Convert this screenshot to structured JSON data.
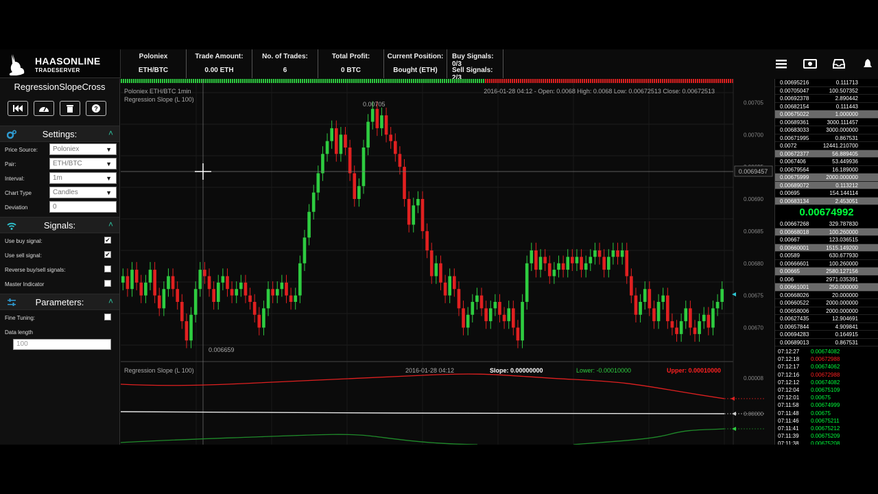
{
  "header": {
    "brand": "HAASONLINE",
    "sub": "TRADESERVER",
    "stats": [
      {
        "label": "Poloniex",
        "value": "ETH/BTC"
      },
      {
        "label": "Trade Amount:",
        "value": "0.00 ETH"
      },
      {
        "label": "No. of Trades:",
        "value": "6"
      },
      {
        "label": "Total Profit:",
        "value": "0 BTC"
      },
      {
        "label": "Current Position:",
        "value": "Bought (ETH)"
      }
    ],
    "buy_signals": "Buy Signals: 0/3",
    "sell_signals": "Sell Signals: 2/3",
    "icons": [
      "menu-icon",
      "money-icon",
      "inbox-icon",
      "bell-icon"
    ]
  },
  "sidebar": {
    "bot_name": "RegressionSlopeCross",
    "buttons": [
      "rewind-icon",
      "dashboard-icon",
      "trash-icon",
      "help-icon"
    ],
    "settings_title": "Settings:",
    "price_source_label": "Price Source:",
    "price_source": "Poloniex",
    "pair_label": "Pair:",
    "pair": "ETH/BTC",
    "interval_label": "Interval:",
    "interval": "1m",
    "chart_type_label": "Chart Type",
    "chart_type": "Candles",
    "deviation_label": "Deviation",
    "deviation": "0",
    "signals_title": "Signals:",
    "signals": [
      {
        "label": "Use buy signal:",
        "checked": true
      },
      {
        "label": "Use sell signal:",
        "checked": true
      },
      {
        "label": "Reverse buy/sell signals:",
        "checked": false
      },
      {
        "label": "Master Indicator",
        "checked": false
      }
    ],
    "parameters_title": "Parameters:",
    "fine_tuning_label": "Fine Tuning:",
    "data_length_label": "Data length",
    "data_length": "100"
  },
  "chart": {
    "title": "Poloniex ETH/BTC 1min",
    "subtitle": "Regression Slope (L 100)",
    "ohlc": "2016-01-28 04:12 - Open: 0.0068 High: 0.0068 Low: 0.00672513 Close: 0.00672513",
    "high_label": "0.00705",
    "low_label": "0.006659",
    "crosshair_price": "0.0069457",
    "price_ticks": [
      "0.00705",
      "0.00700",
      "0.00695",
      "0.00690",
      "0.00685",
      "0.00680",
      "0.00675",
      "0.00670"
    ],
    "lower_title": "Regression Slope (L 100)",
    "lower_time": "2016-01-28 04:12",
    "slope": "Slope: 0.00000000",
    "lower": "Lower: -0.00010000",
    "upper": "Upper: 0.00010000",
    "lower_ticks": [
      "0.00008",
      "0.00000"
    ],
    "colors": {
      "up": "#2ecc40",
      "down": "#e02020",
      "upper_line": "#e02020",
      "slope_line": "#e8e8e8",
      "lower_line": "#1f8a2a"
    }
  },
  "chart_data": {
    "type": "candlestick",
    "ylim": [
      0.00666,
      0.00706
    ],
    "close": [
      0.00678,
      0.00676,
      0.00679,
      0.00677,
      0.00675,
      0.00677,
      0.00679,
      0.00675,
      0.00673,
      0.00676,
      0.00678,
      0.00676,
      0.00674,
      0.00671,
      0.00668,
      0.00672,
      0.00676,
      0.00679,
      0.00678,
      0.00676,
      0.00674,
      0.00677,
      0.00678,
      0.00676,
      0.00675,
      0.00676,
      0.00677,
      0.00675,
      0.00674,
      0.00672,
      0.0067,
      0.00673,
      0.00676,
      0.00675,
      0.00676,
      0.00677,
      0.00675,
      0.00674,
      0.00675,
      0.0068,
      0.00684,
      0.00688,
      0.00691,
      0.00694,
      0.00697,
      0.00699,
      0.00701,
      0.00697,
      0.007,
      0.00698,
      0.00694,
      0.0069,
      0.00692,
      0.00698,
      0.00702,
      0.00704,
      0.00701,
      0.00703,
      0.007,
      0.00699,
      0.00697,
      0.00695,
      0.0069,
      0.00686,
      0.00689,
      0.0069,
      0.00685,
      0.00682,
      0.00678,
      0.0068,
      0.00677,
      0.00675,
      0.00678,
      0.00676,
      0.00673,
      0.0067,
      0.00672,
      0.00674,
      0.00675,
      0.00673,
      0.00671,
      0.00673,
      0.00674,
      0.00672,
      0.00671,
      0.00673,
      0.0067,
      0.00668,
      0.00674,
      0.0068,
      0.00682,
      0.00679,
      0.00681,
      0.0068,
      0.00678,
      0.00679,
      0.0068,
      0.00679,
      0.00681,
      0.0068,
      0.00681,
      0.00679,
      0.0068,
      0.00681,
      0.00682,
      0.00681,
      0.00679,
      0.00681,
      0.00682,
      0.00681,
      0.00682,
      0.00678,
      0.00675,
      0.00672,
      0.00674,
      0.00676,
      0.00673,
      0.00671,
      0.00674,
      0.00675,
      0.00671,
      0.0067,
      0.00669,
      0.00671,
      0.00673,
      0.0067,
      0.00669,
      0.00671,
      0.00672,
      0.0067,
      0.00673,
      0.00674,
      0.00676
    ],
    "slope": [
      0.0,
      0.0,
      0.0
    ]
  },
  "orderbook": {
    "asks": [
      [
        "0.00695216",
        "0.111713",
        false
      ],
      [
        "0.00705047",
        "100.507352",
        false
      ],
      [
        "0.00692378",
        "2.890442",
        false
      ],
      [
        "0.00682154",
        "0.111443",
        false
      ],
      [
        "0.00675022",
        "1.000000",
        true
      ],
      [
        "0.00689361",
        "3000.111457",
        false
      ],
      [
        "0.00683033",
        "3000.000000",
        false
      ],
      [
        "0.00671995",
        "0.867531",
        false
      ],
      [
        "0.0072",
        "12441.210700",
        false
      ],
      [
        "0.00672377",
        "56.889405",
        true
      ],
      [
        "0.0067406",
        "53.449936",
        false
      ],
      [
        "0.00679564",
        "16.189000",
        false
      ],
      [
        "0.00675999",
        "2000.000000",
        true
      ],
      [
        "0.00689072",
        "0.113212",
        true
      ],
      [
        "0.00695",
        "154.144114",
        false
      ],
      [
        "0.00683134",
        "2.453051",
        true
      ]
    ],
    "last_price": "0.00674992",
    "bids": [
      [
        "0.00667268",
        "329.787830",
        false
      ],
      [
        "0.00668018",
        "100.260000",
        true
      ],
      [
        "0.00667",
        "123.036515",
        false
      ],
      [
        "0.00660001",
        "1515.149200",
        true
      ],
      [
        "0.00589",
        "630.677930",
        false
      ],
      [
        "0.00666601",
        "100.260000",
        false
      ],
      [
        "0.00665",
        "2580.127156",
        true
      ],
      [
        "0.006",
        "2971.035391",
        false
      ],
      [
        "0.00661001",
        "250.000000",
        true
      ],
      [
        "0.00668026",
        "20.000000",
        false
      ],
      [
        "0.00660522",
        "2000.000000",
        false
      ],
      [
        "0.00658006",
        "2000.000000",
        false
      ],
      [
        "0.00627435",
        "12.904691",
        false
      ],
      [
        "0.00657844",
        "4.909841",
        false
      ],
      [
        "0.00694283",
        "0.164915",
        false
      ],
      [
        "0.00689013",
        "0.867531",
        false
      ]
    ],
    "trades": [
      [
        "07:12:27",
        "0.00674082",
        false
      ],
      [
        "07:12:18",
        "0.00672988",
        true
      ],
      [
        "07:12:17",
        "0.00674062",
        false
      ],
      [
        "07:12:16",
        "0.00672988",
        true
      ],
      [
        "07:12:12",
        "0.00674082",
        false
      ],
      [
        "07:12:04",
        "0.00675109",
        false
      ],
      [
        "07:12:01",
        "0.00675",
        false
      ],
      [
        "07:11:58",
        "0.00674999",
        false
      ],
      [
        "07:11:48",
        "0.00675",
        false
      ],
      [
        "07:11:46",
        "0.00675211",
        false
      ],
      [
        "07:11:41",
        "0.00675212",
        false
      ],
      [
        "07:11:39",
        "0.00675209",
        false
      ],
      [
        "07:11:38",
        "0.00675208",
        false
      ]
    ]
  }
}
